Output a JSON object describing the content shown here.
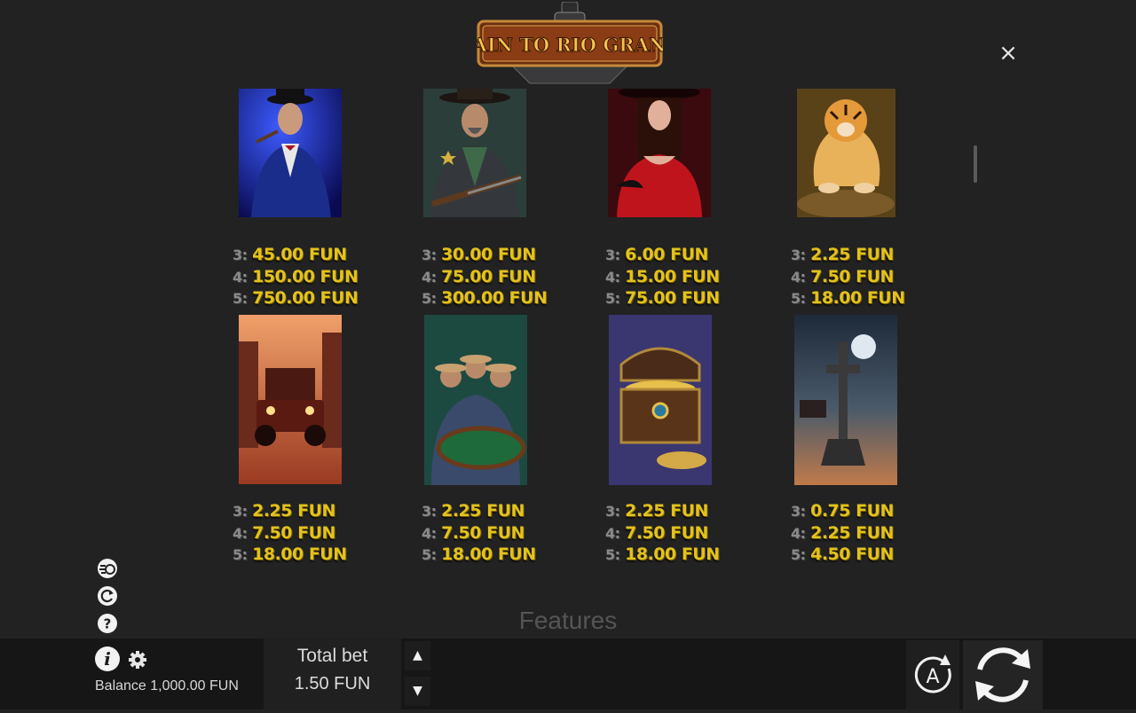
{
  "header": {
    "logo_text": "TRAIN TO RIO GRANDE",
    "close_label": "×"
  },
  "paytable": {
    "symbols": [
      {
        "name": "gentleman",
        "payouts": [
          {
            "count": "3:",
            "value": "45.00 FUN"
          },
          {
            "count": "4:",
            "value": "150.00 FUN"
          },
          {
            "count": "5:",
            "value": "750.00 FUN"
          }
        ]
      },
      {
        "name": "sheriff",
        "payouts": [
          {
            "count": "3:",
            "value": "30.00 FUN"
          },
          {
            "count": "4:",
            "value": "75.00 FUN"
          },
          {
            "count": "5:",
            "value": "300.00 FUN"
          }
        ]
      },
      {
        "name": "lady",
        "payouts": [
          {
            "count": "3:",
            "value": "6.00 FUN"
          },
          {
            "count": "4:",
            "value": "15.00 FUN"
          },
          {
            "count": "5:",
            "value": "75.00 FUN"
          }
        ]
      },
      {
        "name": "tiger",
        "payouts": [
          {
            "count": "3:",
            "value": "2.25 FUN"
          },
          {
            "count": "4:",
            "value": "7.50 FUN"
          },
          {
            "count": "5:",
            "value": "18.00 FUN"
          }
        ]
      },
      {
        "name": "car",
        "payouts": [
          {
            "count": "3:",
            "value": "2.25 FUN"
          },
          {
            "count": "4:",
            "value": "7.50 FUN"
          },
          {
            "count": "5:",
            "value": "18.00 FUN"
          }
        ]
      },
      {
        "name": "poker-table",
        "payouts": [
          {
            "count": "3:",
            "value": "2.25 FUN"
          },
          {
            "count": "4:",
            "value": "7.50 FUN"
          },
          {
            "count": "5:",
            "value": "18.00 FUN"
          }
        ]
      },
      {
        "name": "treasure-chest",
        "payouts": [
          {
            "count": "3:",
            "value": "2.25 FUN"
          },
          {
            "count": "4:",
            "value": "7.50 FUN"
          },
          {
            "count": "5:",
            "value": "18.00 FUN"
          }
        ]
      },
      {
        "name": "grave-cross",
        "payouts": [
          {
            "count": "3:",
            "value": "0.75 FUN"
          },
          {
            "count": "4:",
            "value": "2.25 FUN"
          },
          {
            "count": "5:",
            "value": "4.50 FUN"
          }
        ]
      }
    ],
    "next_section_heading": "Features"
  },
  "side_icons": [
    "speed-icon",
    "replay-icon",
    "help-icon"
  ],
  "bottom_bar": {
    "balance_label": "Balance",
    "balance_value": "1,000.00 FUN",
    "total_bet_label": "Total bet",
    "total_bet_value": "1.50 FUN",
    "autoplay_label": "A"
  },
  "colors": {
    "background": "#222223",
    "payout_gold": "#e3c21c",
    "count_grey": "#8a8a8a",
    "bottom_bar": "#161616"
  }
}
